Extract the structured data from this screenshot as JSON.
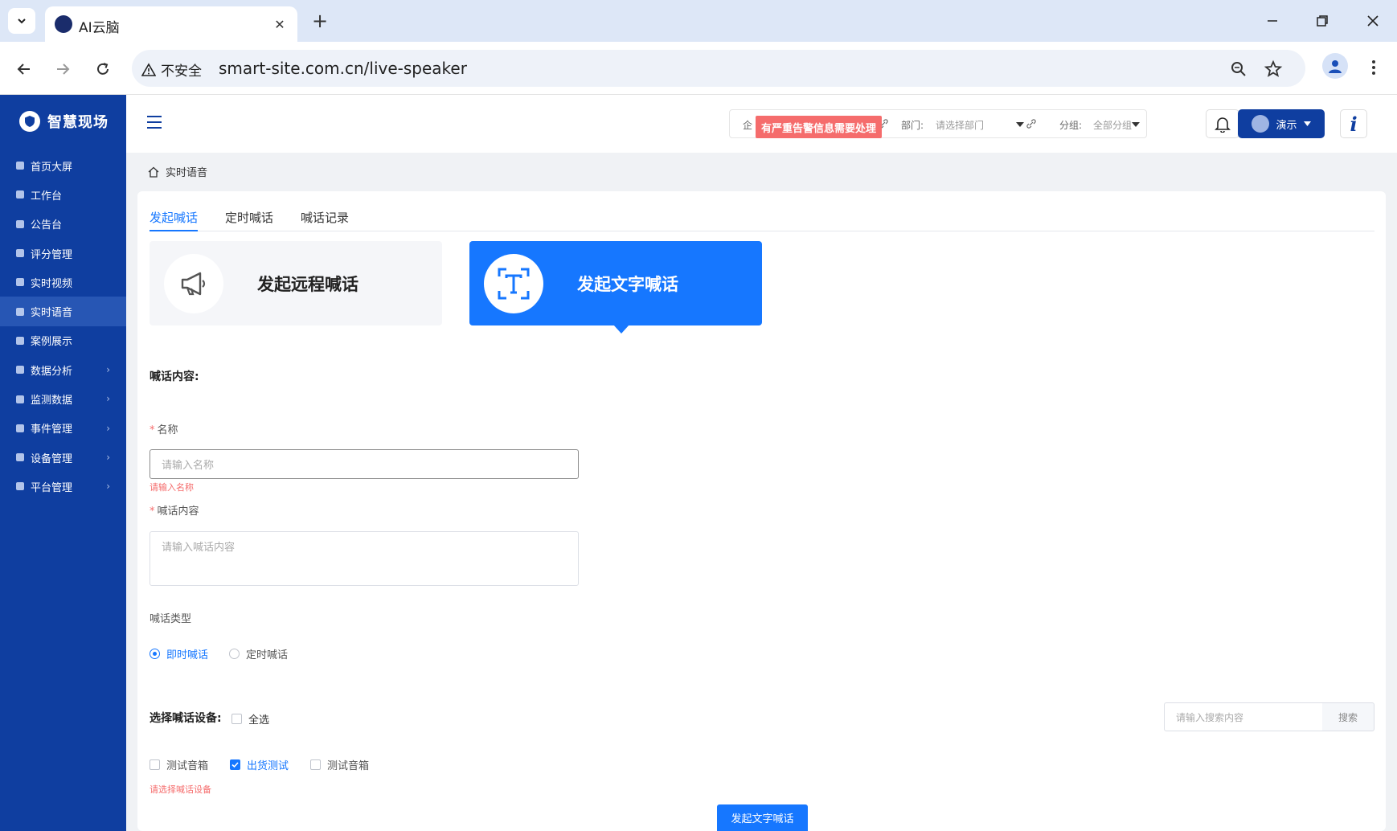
{
  "browser": {
    "tab_title": "AI云脑",
    "security_label": "不安全",
    "url": "smart-site.com.cn/live-speaker"
  },
  "sidebar": {
    "brand": "智慧现场",
    "items": [
      {
        "label": "首页大屏",
        "has_submenu": false
      },
      {
        "label": "工作台",
        "has_submenu": false
      },
      {
        "label": "公告台",
        "has_submenu": false
      },
      {
        "label": "评分管理",
        "has_submenu": false
      },
      {
        "label": "实时视频",
        "has_submenu": false
      },
      {
        "label": "实时语音",
        "has_submenu": false,
        "active": true
      },
      {
        "label": "案例展示",
        "has_submenu": false
      },
      {
        "label": "数据分析",
        "has_submenu": true
      },
      {
        "label": "监测数据",
        "has_submenu": true
      },
      {
        "label": "事件管理",
        "has_submenu": true
      },
      {
        "label": "设备管理",
        "has_submenu": true
      },
      {
        "label": "平台管理",
        "has_submenu": true
      }
    ]
  },
  "header": {
    "company_prefix": "企",
    "alert": "有严重告警信息需要处理",
    "dept_label": "部门:",
    "dept_placeholder": "请选择部门",
    "group_label": "分组:",
    "group_value": "全部分组",
    "user_label": "演示",
    "info_label": "i"
  },
  "breadcrumb": {
    "current": "实时语音"
  },
  "tabs": [
    {
      "label": "发起喊话",
      "active": true
    },
    {
      "label": "定时喊话",
      "active": false
    },
    {
      "label": "喊话记录",
      "active": false
    }
  ],
  "modes": {
    "remote": "发起远程喊话",
    "text": "发起文字喊话"
  },
  "form": {
    "section_title": "喊话内容:",
    "name_label": "名称",
    "name_placeholder": "请输入名称",
    "name_error": "请输入名称",
    "content_label": "喊话内容",
    "content_placeholder": "请输入喊话内容",
    "type_label": "喊话类型",
    "type_options": [
      {
        "label": "即时喊话",
        "selected": true
      },
      {
        "label": "定时喊话",
        "selected": false
      }
    ]
  },
  "devices": {
    "title": "选择喊话设备:",
    "select_all": "全选",
    "search_placeholder": "请输入搜索内容",
    "search_button": "搜索",
    "items": [
      {
        "label": "测试音箱",
        "checked": false
      },
      {
        "label": "出货测试",
        "checked": true
      },
      {
        "label": "测试音箱",
        "checked": false
      }
    ],
    "error": "请选择喊话设备"
  },
  "submit_label": "发起文字喊话"
}
